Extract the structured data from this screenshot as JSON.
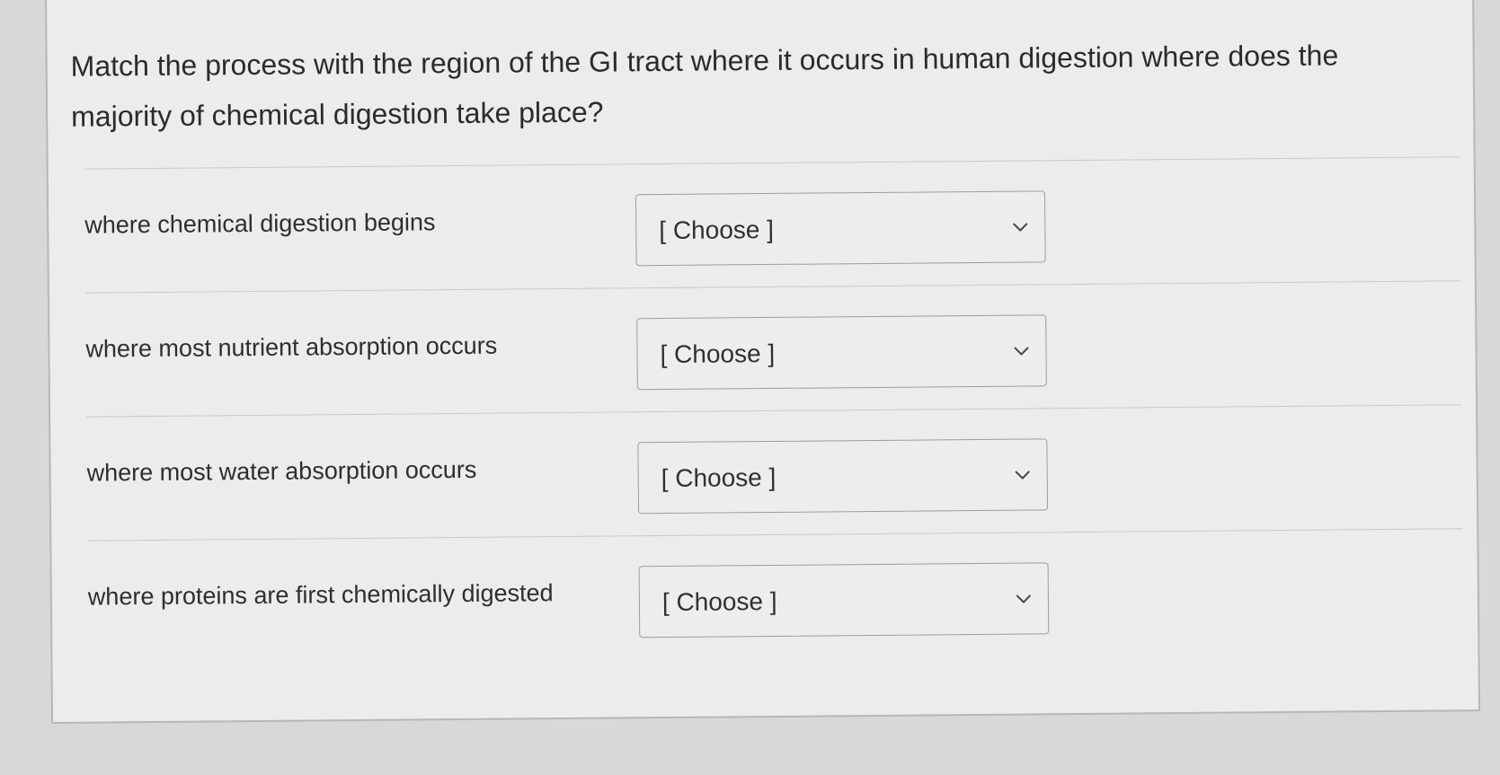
{
  "question": {
    "text": "Match the process with the region of the GI tract where it occurs in human digestion where does the majority of chemical digestion take place?"
  },
  "rows": [
    {
      "prompt": "where chemical digestion begins",
      "selected": "[ Choose ]",
      "icon": "chevron-down-icon"
    },
    {
      "prompt": "where most nutrient absorption occurs",
      "selected": "[ Choose ]",
      "icon": "chevron-down-icon"
    },
    {
      "prompt": "where most water absorption occurs",
      "selected": "[ Choose ]",
      "icon": "chevron-down-icon"
    },
    {
      "prompt": "where proteins are first chemically digested",
      "selected": "[ Choose ]",
      "icon": "chevron-down-icon"
    }
  ]
}
